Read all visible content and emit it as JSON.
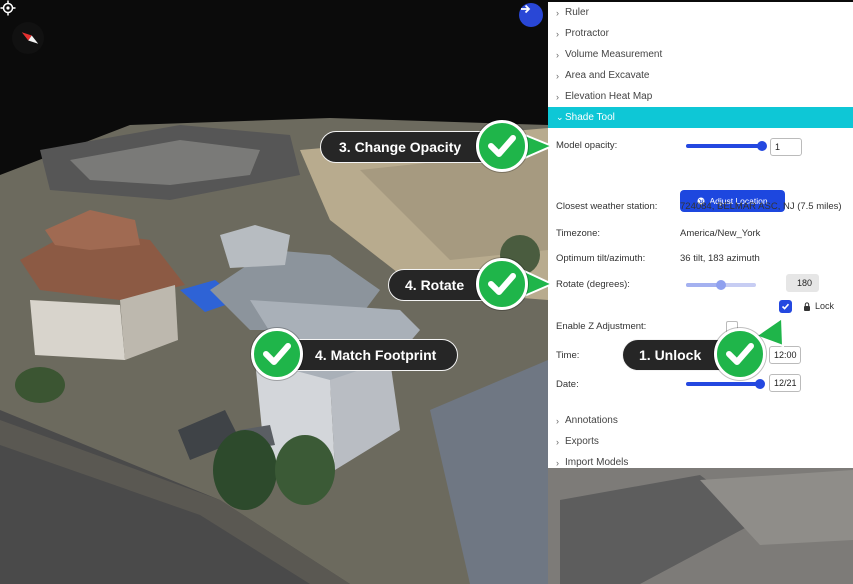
{
  "panel": {
    "collapse_icon": "arrow-right-icon",
    "sections_top": [
      {
        "label": "Ruler"
      },
      {
        "label": "Protractor"
      },
      {
        "label": "Volume Measurement"
      },
      {
        "label": "Area and Excavate"
      },
      {
        "label": "Elevation Heat Map"
      }
    ],
    "open_section": {
      "label": "Shade Tool"
    },
    "shade_tool": {
      "model_opacity_label": "Model opacity:",
      "model_opacity_value": "1",
      "model_opacity_fraction": 1.0,
      "adjust_location_label": "Adjust Location",
      "weather_label": "Closest weather station:",
      "weather_value": "724084, BELMAR ASC, NJ (7.5 miles)",
      "timezone_label": "Timezone:",
      "timezone_value": "America/New_York",
      "tilt_label": "Optimum tilt/azimuth:",
      "tilt_value": "36 tilt, 183 azimuth",
      "rotate_label": "Rotate (degrees):",
      "rotate_value": "180",
      "rotate_fraction": 0.5,
      "lock_checked": true,
      "lock_label": "Lock",
      "z_adjust_label": "Enable Z Adjustment:",
      "time_label": "Time:",
      "time_value": "12:00",
      "date_label": "Date:",
      "date_value": "12/21",
      "date_fraction": 1.0
    },
    "sections_bottom": [
      {
        "label": "Annotations"
      },
      {
        "label": "Exports"
      },
      {
        "label": "Import Models"
      }
    ]
  },
  "callouts": {
    "opacity": "3. Change Opacity",
    "rotate": "4. Rotate",
    "footprint": "4. Match Footprint",
    "unlock": "1. Unlock"
  },
  "colors": {
    "accent": "#0ec7d6",
    "primary": "#2448e0",
    "badge_green": "#1fb54a"
  }
}
